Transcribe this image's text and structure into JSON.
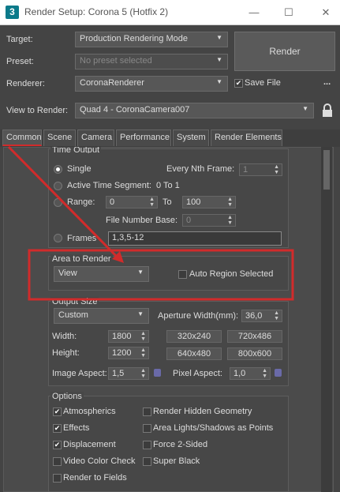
{
  "window": {
    "title": "Render Setup: Corona 5 (Hotfix 2)",
    "logo": "3",
    "minimize_icon": "—",
    "maximize_icon": "☐",
    "close_icon": "✕"
  },
  "top": {
    "target_label": "Target:",
    "target_value": "Production Rendering Mode",
    "preset_label": "Preset:",
    "preset_value": "No preset selected",
    "renderer_label": "Renderer:",
    "renderer_value": "CoronaRenderer",
    "save_file_label": "Save File",
    "more_label": "...",
    "view_label": "View to Render:",
    "view_value": "Quad 4 - CoronaCamera007",
    "render_button": "Render"
  },
  "tabs": [
    "Common",
    "Scene",
    "Camera",
    "Performance",
    "System",
    "Render Elements"
  ],
  "time_output": {
    "title": "Time Output",
    "single": "Single",
    "every_nth": "Every Nth Frame:",
    "every_nth_value": "1",
    "active_segment": "Active Time Segment:",
    "active_segment_range": "0 To 1",
    "range": "Range:",
    "range_from": "0",
    "range_to_label": "To",
    "range_to": "100",
    "file_number_base": "File Number Base:",
    "file_number_base_value": "0",
    "frames": "Frames",
    "frames_value": "1,3,5-12"
  },
  "area_to_render": {
    "title": "Area to Render",
    "value": "View",
    "auto_region": "Auto Region Selected"
  },
  "output_size": {
    "title": "Output Size",
    "preset": "Custom",
    "aperture_label": "Aperture Width(mm):",
    "aperture_value": "36,0",
    "width_label": "Width:",
    "width_value": "1800",
    "height_label": "Height:",
    "height_value": "1200",
    "presets": [
      "320x240",
      "720x486",
      "640x480",
      "800x600"
    ],
    "image_aspect_label": "Image Aspect:",
    "image_aspect_value": "1,5",
    "pixel_aspect_label": "Pixel Aspect:",
    "pixel_aspect_value": "1,0"
  },
  "options": {
    "title": "Options",
    "left": [
      {
        "label": "Atmospherics",
        "checked": true
      },
      {
        "label": "Effects",
        "checked": true
      },
      {
        "label": "Displacement",
        "checked": true
      },
      {
        "label": "Video Color Check",
        "checked": false
      },
      {
        "label": "Render to Fields",
        "checked": false
      }
    ],
    "right": [
      {
        "label": "Render Hidden Geometry",
        "checked": false
      },
      {
        "label": "Area Lights/Shadows as Points",
        "checked": false
      },
      {
        "label": "Force 2-Sided",
        "checked": false
      },
      {
        "label": "Super Black",
        "checked": false
      }
    ]
  },
  "colors": {
    "annotation": "#d12b2b",
    "accent": "#0b7a8a"
  }
}
